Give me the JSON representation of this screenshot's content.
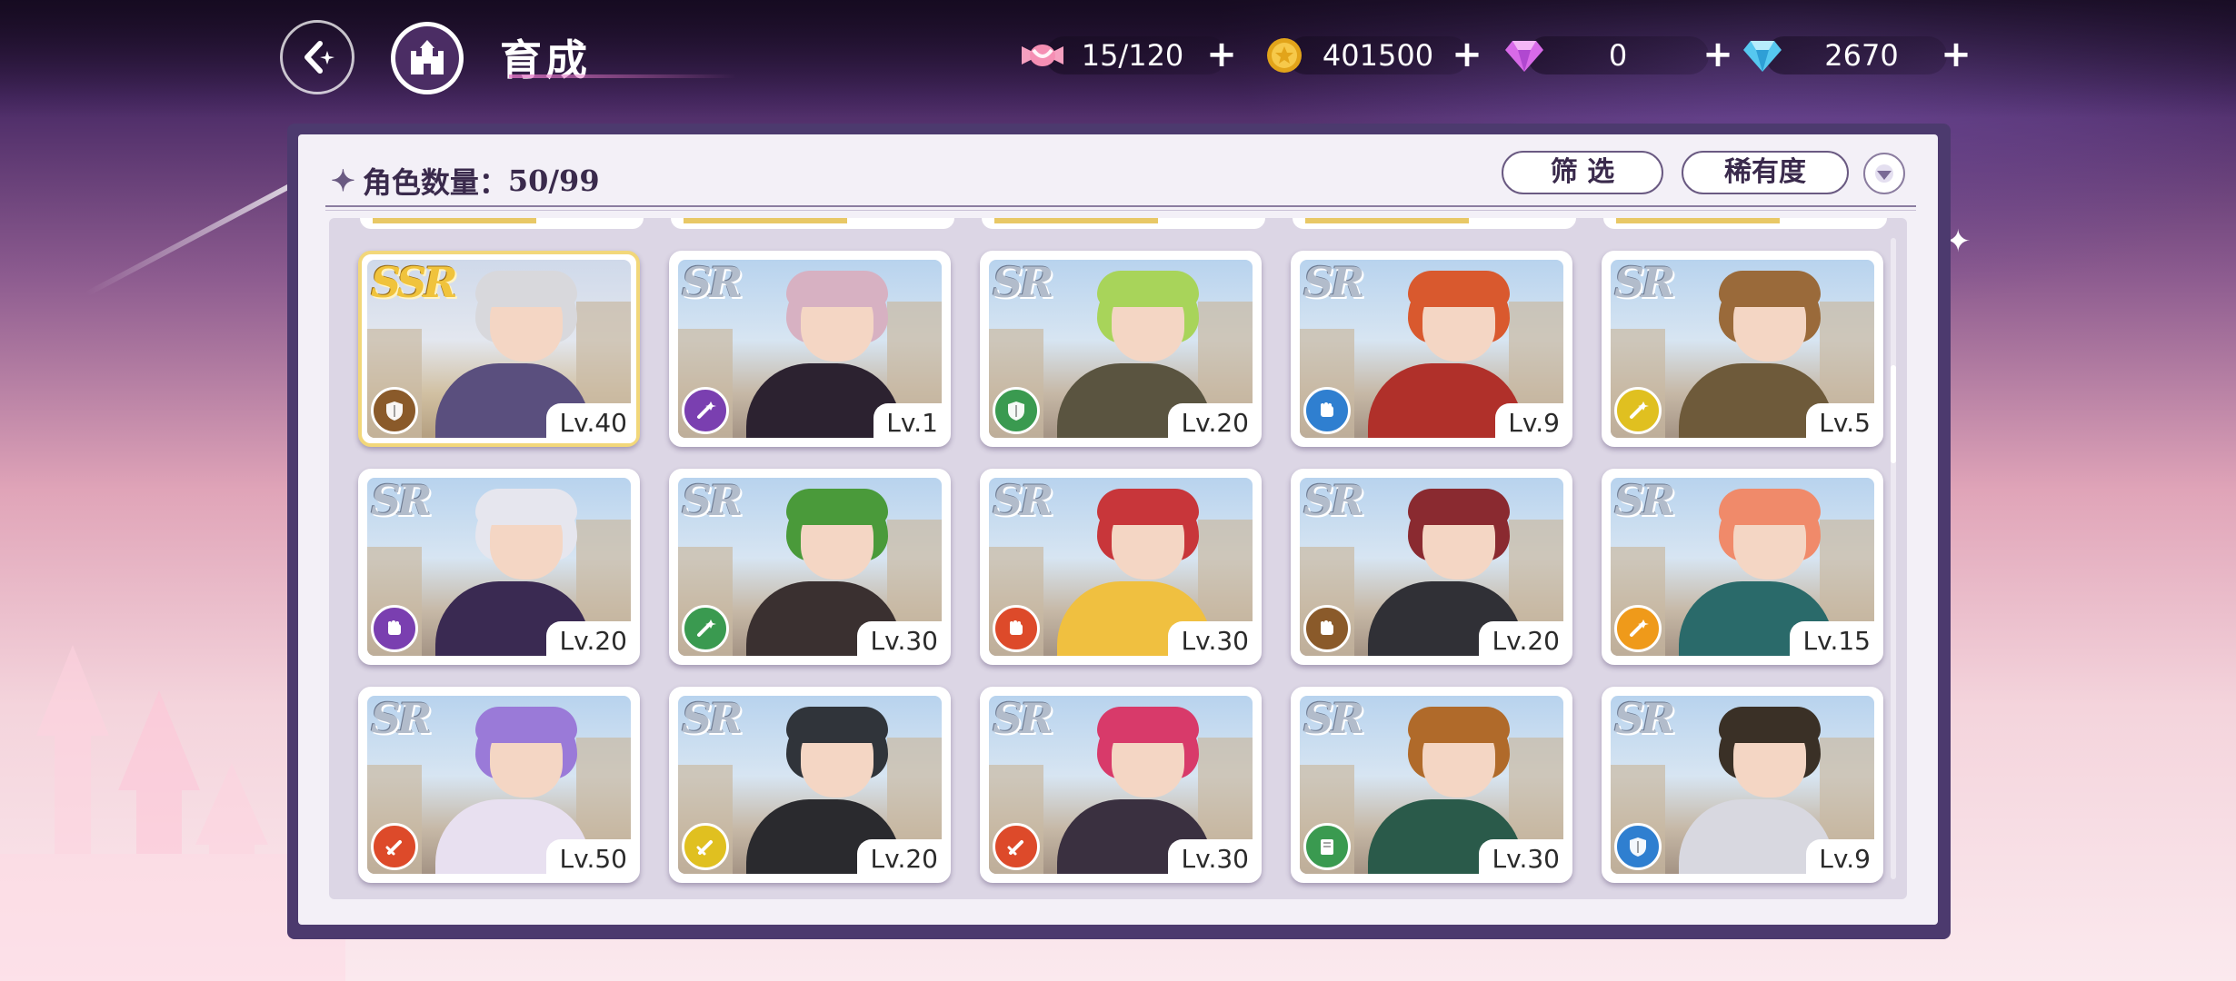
{
  "header": {
    "title": "育成",
    "resources": [
      {
        "icon": "candy-icon",
        "value": "15/120"
      },
      {
        "icon": "gold-coin-icon",
        "value": "401500"
      },
      {
        "icon": "pink-gem-icon",
        "value": "0"
      },
      {
        "icon": "blue-diamond-icon",
        "value": "2670"
      }
    ]
  },
  "panel": {
    "count_label": "角色数量：",
    "count_value": "50/99",
    "filter_label": "筛 选",
    "sort_label": "稀有度"
  },
  "characters": [
    {
      "rarity": "SSR",
      "level": "Lv.40",
      "attr": "shield",
      "attr_color": "brown",
      "hair": "#d8d8dc",
      "outfit": "#5a4f7e"
    },
    {
      "rarity": "SR",
      "level": "Lv.1",
      "attr": "wand",
      "attr_color": "purple",
      "hair": "#d7b1c2",
      "outfit": "#2c2230"
    },
    {
      "rarity": "SR",
      "level": "Lv.20",
      "attr": "shield",
      "attr_color": "green",
      "hair": "#a8d45a",
      "outfit": "#5a5440"
    },
    {
      "rarity": "SR",
      "level": "Lv.9",
      "attr": "fist",
      "attr_color": "blue",
      "hair": "#d9592e",
      "outfit": "#b0302a"
    },
    {
      "rarity": "SR",
      "level": "Lv.5",
      "attr": "wand",
      "attr_color": "yellow",
      "hair": "#9a6a3a",
      "outfit": "#6e5a3a"
    },
    {
      "rarity": "SR",
      "level": "Lv.20",
      "attr": "fist",
      "attr_color": "purple",
      "hair": "#e6e6ee",
      "outfit": "#3a2a52"
    },
    {
      "rarity": "SR",
      "level": "Lv.30",
      "attr": "wand",
      "attr_color": "green",
      "hair": "#4a9a3a",
      "outfit": "#3a3030"
    },
    {
      "rarity": "SR",
      "level": "Lv.30",
      "attr": "fist",
      "attr_color": "red",
      "hair": "#c8363a",
      "outfit": "#f0c040"
    },
    {
      "rarity": "SR",
      "level": "Lv.20",
      "attr": "fist",
      "attr_color": "brown",
      "hair": "#8a2a30",
      "outfit": "#303036"
    },
    {
      "rarity": "SR",
      "level": "Lv.15",
      "attr": "wand",
      "attr_color": "orange",
      "hair": "#f08a6a",
      "outfit": "#2a6a6a"
    },
    {
      "rarity": "SR",
      "level": "Lv.50",
      "attr": "sword",
      "attr_color": "red",
      "hair": "#9a7ad8",
      "outfit": "#e8e0f0"
    },
    {
      "rarity": "SR",
      "level": "Lv.20",
      "attr": "sword",
      "attr_color": "yellow",
      "hair": "#30343a",
      "outfit": "#2a2a2e"
    },
    {
      "rarity": "SR",
      "level": "Lv.30",
      "attr": "sword",
      "attr_color": "red",
      "hair": "#d83a6a",
      "outfit": "#3a3040"
    },
    {
      "rarity": "SR",
      "level": "Lv.30",
      "attr": "book",
      "attr_color": "green",
      "hair": "#b06a2a",
      "outfit": "#2a5a4a"
    },
    {
      "rarity": "SR",
      "level": "Lv.9",
      "attr": "shield",
      "attr_color": "blue",
      "hair": "#3a3026",
      "outfit": "#d8d8e0"
    }
  ]
}
